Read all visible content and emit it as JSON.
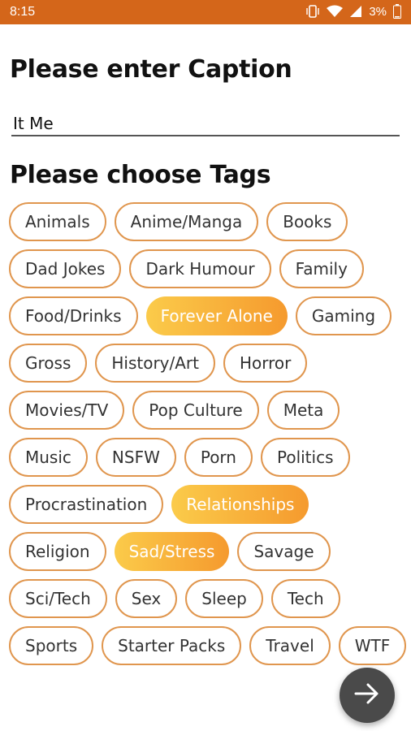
{
  "status_bar": {
    "time": "8:15",
    "battery": "3%",
    "icons": [
      "vibrate-icon",
      "wifi-icon",
      "signal-icon",
      "battery-icon"
    ],
    "color": "#d4661a"
  },
  "caption": {
    "title": "Please enter Caption",
    "value": "It Me"
  },
  "tags": {
    "title": "Please choose Tags",
    "accent_color": "#e0964e",
    "selected_gradient": [
      "#fbcb4a",
      "#f59a2e"
    ],
    "items": [
      {
        "label": "Animals",
        "selected": false
      },
      {
        "label": "Anime/Manga",
        "selected": false
      },
      {
        "label": "Books",
        "selected": false
      },
      {
        "label": "Dad Jokes",
        "selected": false
      },
      {
        "label": "Dark Humour",
        "selected": false
      },
      {
        "label": "Family",
        "selected": false
      },
      {
        "label": "Food/Drinks",
        "selected": false
      },
      {
        "label": "Forever Alone",
        "selected": true
      },
      {
        "label": "Gaming",
        "selected": false
      },
      {
        "label": "Gross",
        "selected": false
      },
      {
        "label": "History/Art",
        "selected": false
      },
      {
        "label": "Horror",
        "selected": false
      },
      {
        "label": "Movies/TV",
        "selected": false
      },
      {
        "label": "Pop Culture",
        "selected": false
      },
      {
        "label": "Meta",
        "selected": false
      },
      {
        "label": "Music",
        "selected": false
      },
      {
        "label": "NSFW",
        "selected": false
      },
      {
        "label": "Porn",
        "selected": false
      },
      {
        "label": "Politics",
        "selected": false
      },
      {
        "label": "Procrastination",
        "selected": false
      },
      {
        "label": "Relationships",
        "selected": true
      },
      {
        "label": "Religion",
        "selected": false
      },
      {
        "label": "Sad/Stress",
        "selected": true
      },
      {
        "label": "Savage",
        "selected": false
      },
      {
        "label": "Sci/Tech",
        "selected": false
      },
      {
        "label": "Sex",
        "selected": false
      },
      {
        "label": "Sleep",
        "selected": false
      },
      {
        "label": "Tech",
        "selected": false
      },
      {
        "label": "Sports",
        "selected": false
      },
      {
        "label": "Starter Packs",
        "selected": false
      },
      {
        "label": "Travel",
        "selected": false
      },
      {
        "label": "WTF",
        "selected": false
      }
    ]
  },
  "fab": {
    "icon": "arrow-right-icon",
    "color": "#4a4a4a"
  }
}
